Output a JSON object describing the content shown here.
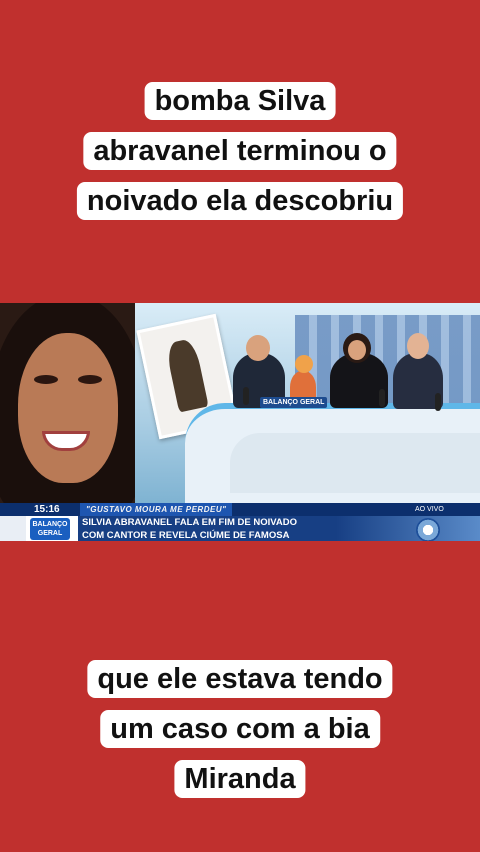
{
  "caption_top": {
    "lines": [
      "bomba Silva",
      "abravanel terminou  o",
      "noivado ela descobriu"
    ]
  },
  "caption_bottom": {
    "lines": [
      "que ele estava tendo",
      "um caso com a bia",
      "Miranda"
    ]
  },
  "video": {
    "time": "15:16",
    "tag": "\"GUSTAVO MOURA ME PERDEU\"",
    "live_label": "AO VIVO",
    "program_logo": "BALANÇO GERAL",
    "headline_lines": [
      "SILVIA ABRAVANEL FALA EM FIM DE NOIVADO",
      "COM CANTOR E REVELA CIÚME DE FAMOSA"
    ],
    "desk_sign": "BALANÇO GERAL"
  },
  "colors": {
    "background": "#c0302e",
    "caption_box": "#ffffff",
    "lower_third": "#173f84"
  },
  "icons": [
    "record-tv-logo-icon"
  ]
}
